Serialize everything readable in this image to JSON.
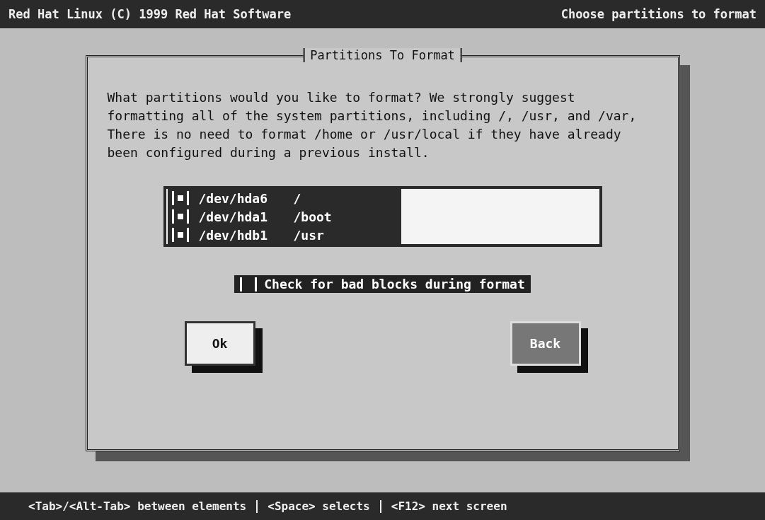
{
  "header": {
    "left": "Red Hat Linux (C) 1999 Red Hat Software",
    "right": "Choose partitions to format"
  },
  "dialog": {
    "title": "Partitions To Format",
    "text": "What partitions would you like to format? We strongly suggest formatting all of the system partitions, including /, /usr, and /var, There is no need to format /home or /usr/local if they have already been configured during a previous install.",
    "partitions": [
      {
        "device": "/dev/hda6",
        "mount": "/",
        "checked": true
      },
      {
        "device": "/dev/hda1",
        "mount": "/boot",
        "checked": true
      },
      {
        "device": "/dev/hdb1",
        "mount": "/usr",
        "checked": true
      }
    ],
    "bad_blocks": {
      "label": "Check for bad blocks during format",
      "checked": false
    },
    "buttons": [
      {
        "label": "Ok",
        "selected": true
      },
      {
        "label": "Back",
        "selected": false
      }
    ]
  },
  "status_bar": [
    "<Tab>/<Alt-Tab> between elements",
    "<Space> selects",
    "<F12> next screen"
  ]
}
